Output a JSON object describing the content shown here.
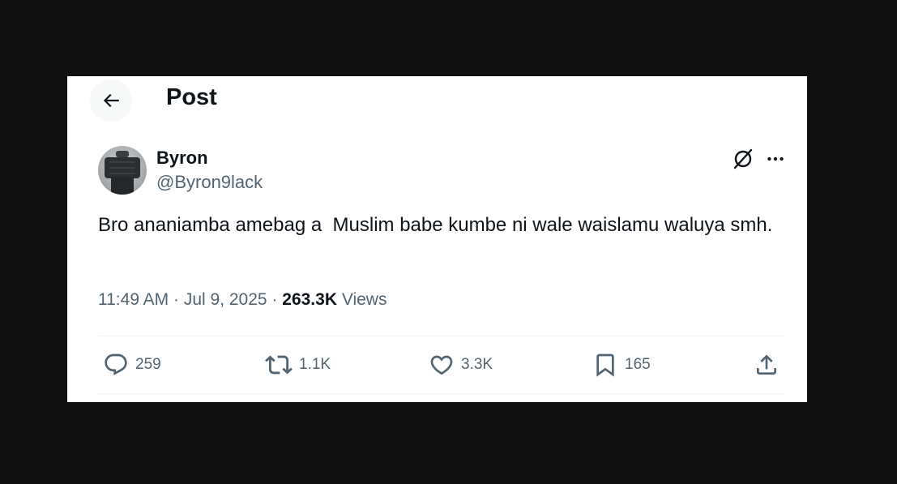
{
  "header": {
    "title": "Post",
    "back_icon": "arrow-left-icon"
  },
  "author": {
    "display_name": "Byron",
    "handle": "@Byron9lack",
    "avatar_icon": "avatar"
  },
  "tweet": {
    "text": "Bro ananiamba amebag a  Muslim babe kumbe ni wale waislamu waluya smh.",
    "time": "11:49 AM",
    "separator1": " · ",
    "date": "Jul 9, 2025",
    "separator2": " · ",
    "views_count": "263.3K",
    "views_label": " Views"
  },
  "actions": {
    "replies": "259",
    "reposts": "1.1K",
    "likes": "3.3K",
    "bookmarks": "165"
  },
  "colors": {
    "background": "#0f0f0f",
    "card": "#ffffff",
    "text_primary": "#0f1419",
    "text_secondary": "#536471",
    "divider": "#eff3f4"
  }
}
